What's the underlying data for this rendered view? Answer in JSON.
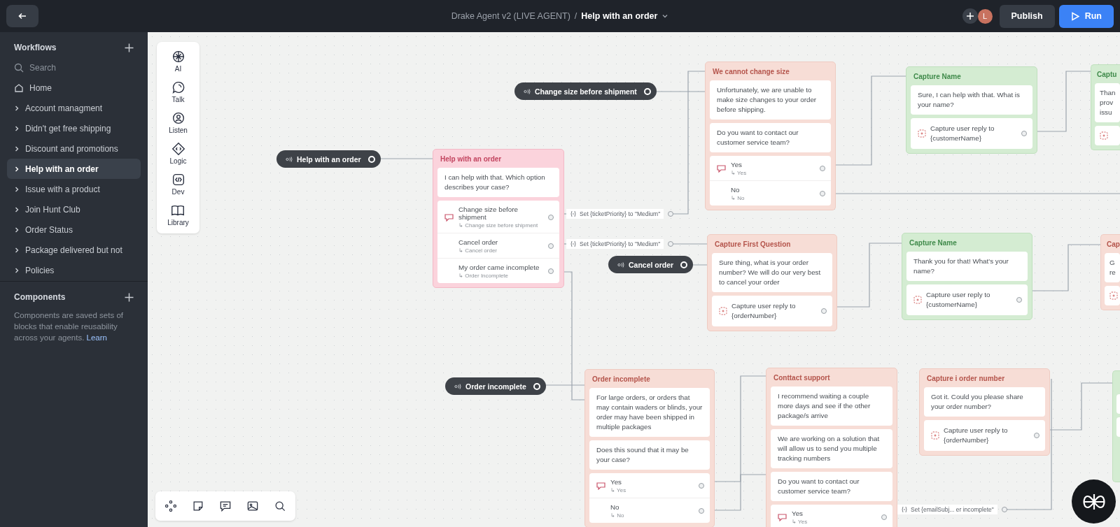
{
  "topbar": {
    "project": "Drake Agent v2 (LIVE AGENT)",
    "separator": "/",
    "workflow": "Help with an order",
    "avatar": "L",
    "publish": "Publish",
    "run": "Run"
  },
  "sidebar": {
    "workflows_title": "Workflows",
    "search_placeholder": "Search",
    "home": "Home",
    "items": [
      {
        "label": "Account managment",
        "selected": false
      },
      {
        "label": "Didn't get free shipping",
        "selected": false
      },
      {
        "label": "Discount and promotions",
        "selected": false
      },
      {
        "label": "Help with an order",
        "selected": true
      },
      {
        "label": "Issue with a product",
        "selected": false
      },
      {
        "label": "Join Hunt Club",
        "selected": false
      },
      {
        "label": "Order Status",
        "selected": false
      },
      {
        "label": "Package delivered but not",
        "selected": false
      },
      {
        "label": "Policies",
        "selected": false
      }
    ],
    "components_title": "Components",
    "components_text": "Components are saved sets of blocks that enable reusability across your agents.",
    "learn_link": "Learn"
  },
  "toolbox": [
    {
      "label": "AI"
    },
    {
      "label": "Talk"
    },
    {
      "label": "Listen"
    },
    {
      "label": "Logic"
    },
    {
      "label": "Dev"
    },
    {
      "label": "Library"
    }
  ],
  "start_nodes": [
    {
      "label": "Help with an order"
    },
    {
      "label": "Change size before shipment"
    },
    {
      "label": "Cancel order"
    },
    {
      "label": "Order incomplete"
    }
  ],
  "blocks": [
    {
      "kind": "intent",
      "title": "Help with an order",
      "steps": [
        {
          "kind": "message",
          "text": "I can help with that. Which option describes your case?"
        },
        {
          "kind": "choices",
          "options": [
            {
              "label": "Change size before shipment",
              "sub": "↳ Change size before shipment"
            },
            {
              "label": "Cancel order",
              "sub": "↳ Cancel order"
            },
            {
              "label": "My order came incomplete",
              "sub": "↳ Order Incomplete"
            }
          ]
        }
      ]
    },
    {
      "kind": "response",
      "title": "We cannot change size",
      "steps": [
        {
          "kind": "message",
          "text": "Unfortunately, we are unable to make size changes to your order before shipping."
        },
        {
          "kind": "message",
          "text": "Do you want to contact our customer service team?"
        },
        {
          "kind": "choices",
          "options": [
            {
              "label": "Yes",
              "sub": "↳ Yes"
            },
            {
              "label": "No",
              "sub": "↳ No"
            }
          ]
        }
      ]
    },
    {
      "kind": "response",
      "title": "Capture First Question",
      "steps": [
        {
          "kind": "message",
          "text": "Sure thing, what is your order number? We will do our very best to cancel your order"
        },
        {
          "kind": "capture",
          "text": "Capture user reply to {orderNumber}"
        }
      ]
    },
    {
      "kind": "capture",
      "title": "Capture Name",
      "steps": [
        {
          "kind": "message",
          "text": "Sure, I can help with that. What is your name?"
        },
        {
          "kind": "capture",
          "text": "Capture user reply to {customerName}"
        }
      ]
    },
    {
      "kind": "capture",
      "title": "Captu",
      "steps": [
        {
          "kind": "message",
          "text": "Than prov issu"
        },
        {
          "kind": "capture"
        }
      ]
    },
    {
      "kind": "capture",
      "title": "Capture Name",
      "steps": [
        {
          "kind": "message",
          "text": "Thank you for that! What's your name?"
        },
        {
          "kind": "capture",
          "text": "Capture user reply to {customerName}"
        }
      ]
    },
    {
      "kind": "response",
      "title": "Cap",
      "steps": [
        {
          "kind": "message",
          "text": "G re"
        },
        {
          "kind": "capture"
        }
      ]
    },
    {
      "kind": "response",
      "title": "Order incomplete",
      "steps": [
        {
          "kind": "message",
          "text": "For large orders, or orders that may contain waders or blinds,  your order may have been shipped in multiple packages"
        },
        {
          "kind": "message",
          "text": "Does this sound that it may be your case?"
        },
        {
          "kind": "choices",
          "options": [
            {
              "label": "Yes",
              "sub": "↳ Yes"
            },
            {
              "label": "No",
              "sub": "↳ No"
            }
          ]
        }
      ]
    },
    {
      "kind": "response",
      "title": "Conttact support",
      "steps": [
        {
          "kind": "message",
          "text": "I recommend waiting a couple more days and see if the other package/s arrive"
        },
        {
          "kind": "message",
          "text": "We are working on a solution that will allow us to send you multiple tracking numbers"
        },
        {
          "kind": "message",
          "text": "Do you want to contact our customer service team?"
        },
        {
          "kind": "choices",
          "options": [
            {
              "label": "Yes",
              "sub": "↳ Yes"
            }
          ]
        }
      ]
    },
    {
      "kind": "response",
      "title": "Capture i order number",
      "steps": [
        {
          "kind": "message",
          "text": "Got it. Could you please share your order number?"
        },
        {
          "kind": "capture",
          "text": "Capture user reply to {orderNumber}"
        }
      ]
    },
    {
      "kind": "capture",
      "steps": [
        {
          "kind": "message"
        },
        {
          "kind": "message"
        }
      ]
    }
  ],
  "actions": [
    {
      "text": "Set {ticketPriority} to \"Medium\""
    },
    {
      "text": "Set {ticketPriority} to \"Medium\""
    },
    {
      "text": "Set {emailSubj... er incomplete\""
    }
  ]
}
